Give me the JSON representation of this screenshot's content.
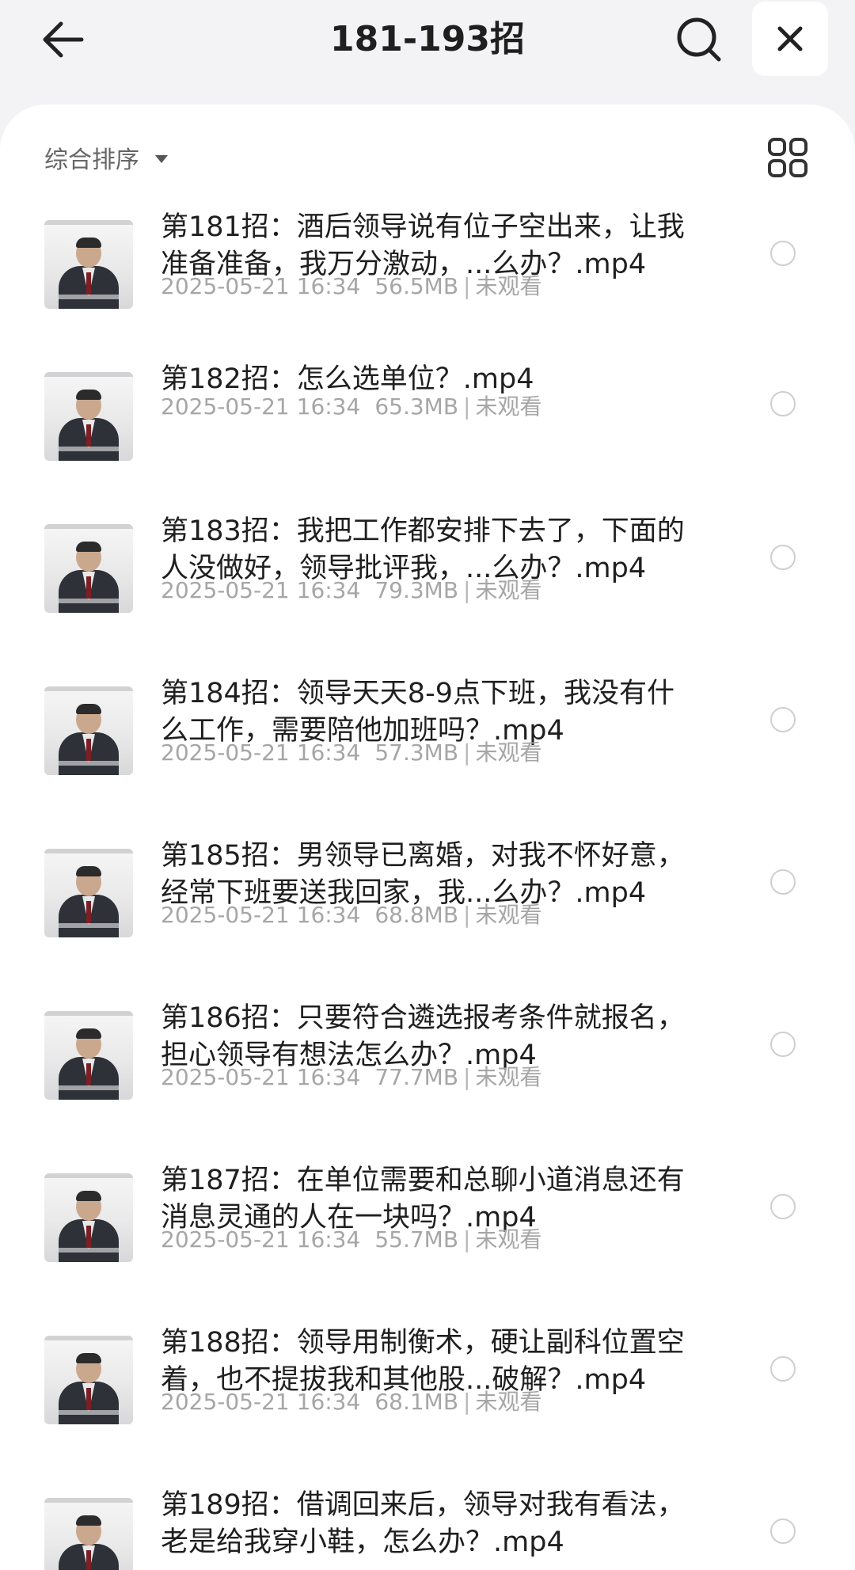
{
  "header": {
    "title": "181-193招"
  },
  "toolbar": {
    "sort_label": "综合排序"
  },
  "files": [
    {
      "name": "第181招：酒后领导说有位子空出来，让我准备准备，我万分激动，...么办？.mp4",
      "date": "2025-05-21 16:34",
      "size": "56.5MB",
      "status": "未观看"
    },
    {
      "name": "第182招：怎么选单位？.mp4",
      "date": "2025-05-21 16:34",
      "size": "65.3MB",
      "status": "未观看"
    },
    {
      "name": "第183招：我把工作都安排下去了，下面的人没做好，领导批评我，...么办？.mp4",
      "date": "2025-05-21 16:34",
      "size": "79.3MB",
      "status": "未观看"
    },
    {
      "name": "第184招：领导天天8-9点下班，我没有什么工作，需要陪他加班吗？.mp4",
      "date": "2025-05-21 16:34",
      "size": "57.3MB",
      "status": "未观看"
    },
    {
      "name": "第185招：男领导已离婚，对我不怀好意，经常下班要送我回家，我...么办？.mp4",
      "date": "2025-05-21 16:34",
      "size": "68.8MB",
      "status": "未观看"
    },
    {
      "name": "第186招：只要符合遴选报考条件就报名，担心领导有想法怎么办？.mp4",
      "date": "2025-05-21 16:34",
      "size": "77.7MB",
      "status": "未观看"
    },
    {
      "name": "第187招：在单位需要和总聊小道消息还有消息灵通的人在一块吗？.mp4",
      "date": "2025-05-21 16:34",
      "size": "55.7MB",
      "status": "未观看"
    },
    {
      "name": "第188招：领导用制衡术，硬让副科位置空着，也不提拔我和其他股...破解？.mp4",
      "date": "2025-05-21 16:34",
      "size": "68.1MB",
      "status": "未观看"
    },
    {
      "name": "第189招：借调回来后，领导对我有看法，老是给我穿小鞋，怎么办？.mp4",
      "date": "",
      "size": "",
      "status": ""
    }
  ]
}
